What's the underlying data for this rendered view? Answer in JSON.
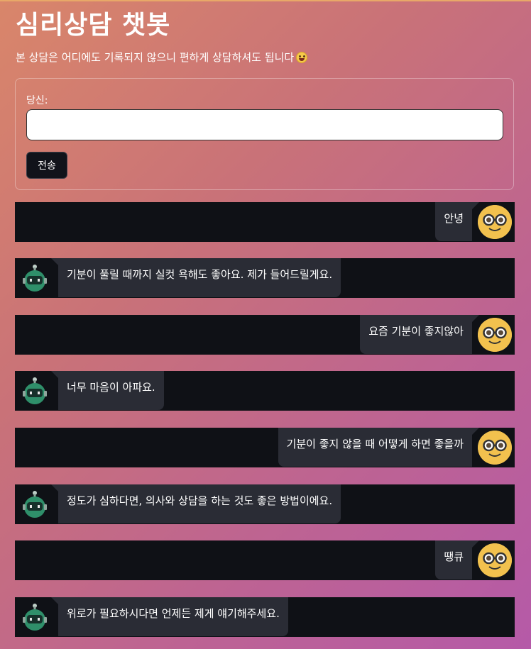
{
  "app": {
    "title": "심리상담 챗봇",
    "subtitle": "본 상담은 어디에도 기록되지 않으니 편하게 상담하셔도 됩니다"
  },
  "form": {
    "label": "당신:",
    "input_value": "",
    "send_label": "전송"
  },
  "messages": [
    {
      "role": "user",
      "text": "안녕"
    },
    {
      "role": "bot",
      "text": "기분이 풀릴 때까지 실컷 욕해도 좋아요. 제가 들어드릴게요."
    },
    {
      "role": "user",
      "text": "요즘 기분이 좋지않아"
    },
    {
      "role": "bot",
      "text": "너무 마음이 아파요."
    },
    {
      "role": "user",
      "text": "기분이 좋지 않을 때 어떻게 하면 좋을까"
    },
    {
      "role": "bot",
      "text": "정도가 심하다면, 의사와 상담을 하는 것도 좋은 방법이에요."
    },
    {
      "role": "user",
      "text": "땡큐"
    },
    {
      "role": "bot",
      "text": "위로가 필요하시다면 언제든 제게 얘기해주세요."
    }
  ],
  "icons": {
    "subtitle_emoji": "grinning-face-icon",
    "user_avatar": "nerd-face-icon",
    "bot_avatar": "robot-icon"
  },
  "colors": {
    "row_background": "#0f1116",
    "bubble_background": "#2a2c35",
    "user_avatar": "#f2c14e",
    "bot_avatar": "#2f8f6a"
  }
}
